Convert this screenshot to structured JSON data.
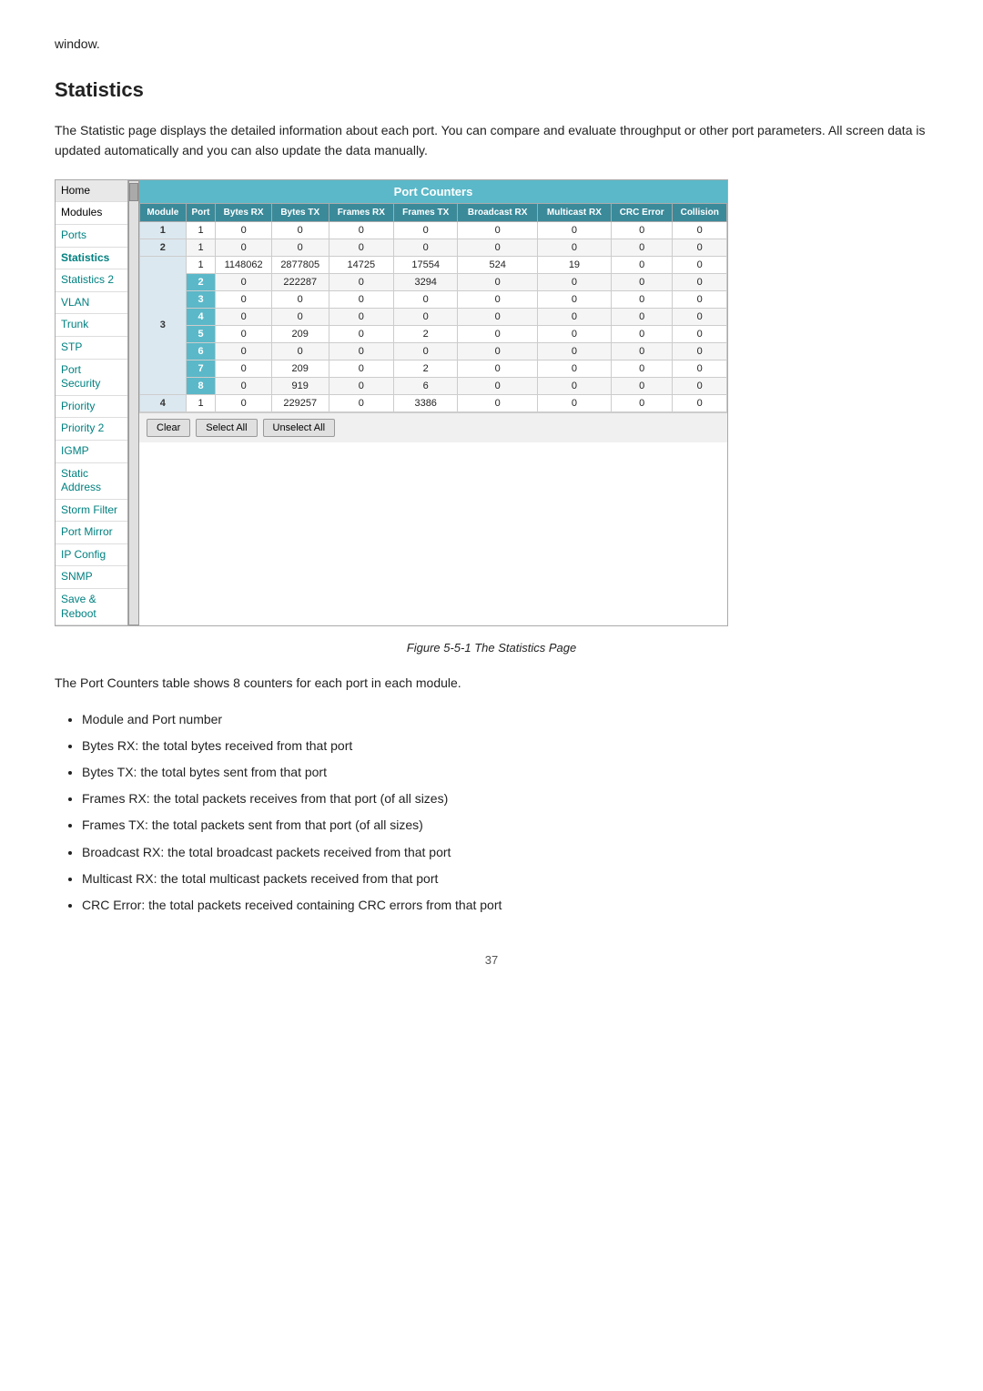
{
  "intro": {
    "window_text": "window."
  },
  "section": {
    "title": "Statistics",
    "description": "The Statistic page displays the detailed information about each port. You can compare and evaluate throughput or other port parameters. All screen data is updated automatically and you can also update the data manually."
  },
  "sidebar": {
    "items": [
      {
        "label": "Home",
        "active": false
      },
      {
        "label": "Modules",
        "active": false
      },
      {
        "label": "Ports",
        "active": false
      },
      {
        "label": "Statistics",
        "active": true
      },
      {
        "label": "Statistics 2",
        "active": false
      },
      {
        "label": "VLAN",
        "active": false
      },
      {
        "label": "Trunk",
        "active": false
      },
      {
        "label": "STP",
        "active": false
      },
      {
        "label": "Port Security",
        "active": false
      },
      {
        "label": "Priority",
        "active": false
      },
      {
        "label": "Priority 2",
        "active": false
      },
      {
        "label": "IGMP",
        "active": false
      },
      {
        "label": "Static Address",
        "active": false
      },
      {
        "label": "Storm Filter",
        "active": false
      },
      {
        "label": "Port Mirror",
        "active": false
      },
      {
        "label": "IP Config",
        "active": false
      },
      {
        "label": "SNMP",
        "active": false
      },
      {
        "label": "Save & Reboot",
        "active": false
      }
    ]
  },
  "port_counters": {
    "header": "Port Counters",
    "columns": [
      "Module",
      "Port",
      "Bytes RX",
      "Bytes TX",
      "Frames RX",
      "Frames TX",
      "Broadcast RX",
      "Multicast RX",
      "CRC Error",
      "Collision"
    ],
    "rows": [
      {
        "module": "1",
        "port": "1",
        "bytes_rx": "0",
        "bytes_tx": "0",
        "frames_rx": "0",
        "frames_tx": "0",
        "broadcast_rx": "0",
        "multicast_rx": "0",
        "crc_error": "0",
        "collision": "0"
      },
      {
        "module": "2",
        "port": "1",
        "bytes_rx": "0",
        "bytes_tx": "0",
        "frames_rx": "0",
        "frames_tx": "0",
        "broadcast_rx": "0",
        "multicast_rx": "0",
        "crc_error": "0",
        "collision": "0"
      },
      {
        "module": "3p1",
        "port": "1",
        "bytes_rx": "1148062",
        "bytes_tx": "2877805",
        "frames_rx": "14725",
        "frames_tx": "17554",
        "broadcast_rx": "524",
        "multicast_rx": "19",
        "crc_error": "0",
        "collision": "0"
      },
      {
        "module": "3p2",
        "port": "2",
        "bytes_rx": "0",
        "bytes_tx": "222287",
        "frames_rx": "0",
        "frames_tx": "3294",
        "broadcast_rx": "0",
        "multicast_rx": "0",
        "crc_error": "0",
        "collision": "0"
      },
      {
        "module": "3p3",
        "port": "3",
        "bytes_rx": "0",
        "bytes_tx": "0",
        "frames_rx": "0",
        "frames_tx": "0",
        "broadcast_rx": "0",
        "multicast_rx": "0",
        "crc_error": "0",
        "collision": "0"
      },
      {
        "module": "3p4",
        "port": "4",
        "bytes_rx": "0",
        "bytes_tx": "0",
        "frames_rx": "0",
        "frames_tx": "0",
        "broadcast_rx": "0",
        "multicast_rx": "0",
        "crc_error": "0",
        "collision": "0"
      },
      {
        "module": "3p5",
        "port": "5",
        "bytes_rx": "0",
        "bytes_tx": "209",
        "frames_rx": "0",
        "frames_tx": "2",
        "broadcast_rx": "0",
        "multicast_rx": "0",
        "crc_error": "0",
        "collision": "0"
      },
      {
        "module": "3p6",
        "port": "6",
        "bytes_rx": "0",
        "bytes_tx": "0",
        "frames_rx": "0",
        "frames_tx": "0",
        "broadcast_rx": "0",
        "multicast_rx": "0",
        "crc_error": "0",
        "collision": "0"
      },
      {
        "module": "3p7",
        "port": "7",
        "bytes_rx": "0",
        "bytes_tx": "209",
        "frames_rx": "0",
        "frames_tx": "2",
        "broadcast_rx": "0",
        "multicast_rx": "0",
        "crc_error": "0",
        "collision": "0"
      },
      {
        "module": "3p8",
        "port": "8",
        "bytes_rx": "0",
        "bytes_tx": "919",
        "frames_rx": "0",
        "frames_tx": "6",
        "broadcast_rx": "0",
        "multicast_rx": "0",
        "crc_error": "0",
        "collision": "0"
      },
      {
        "module": "4",
        "port": "1",
        "bytes_rx": "0",
        "bytes_tx": "229257",
        "frames_rx": "0",
        "frames_tx": "3386",
        "broadcast_rx": "0",
        "multicast_rx": "0",
        "crc_error": "0",
        "collision": "0"
      }
    ],
    "buttons": [
      "Clear",
      "Select All",
      "Unselect All"
    ]
  },
  "figure_caption": "Figure 5-5-1 The Statistics Page",
  "port_counters_desc": "The Port Counters table shows 8 counters for each port in each module.",
  "bullet_items": [
    "Module and Port number",
    "Bytes RX: the total bytes received from that port",
    "Bytes TX: the total bytes sent from that port",
    "Frames RX: the total packets receives from that port (of all sizes)",
    "Frames TX: the total packets sent from that port (of all sizes)",
    "Broadcast RX: the total broadcast packets received from that port",
    "Multicast RX: the total multicast packets received from that port",
    "CRC Error: the total packets received containing CRC errors from that port"
  ],
  "page_number": "37"
}
